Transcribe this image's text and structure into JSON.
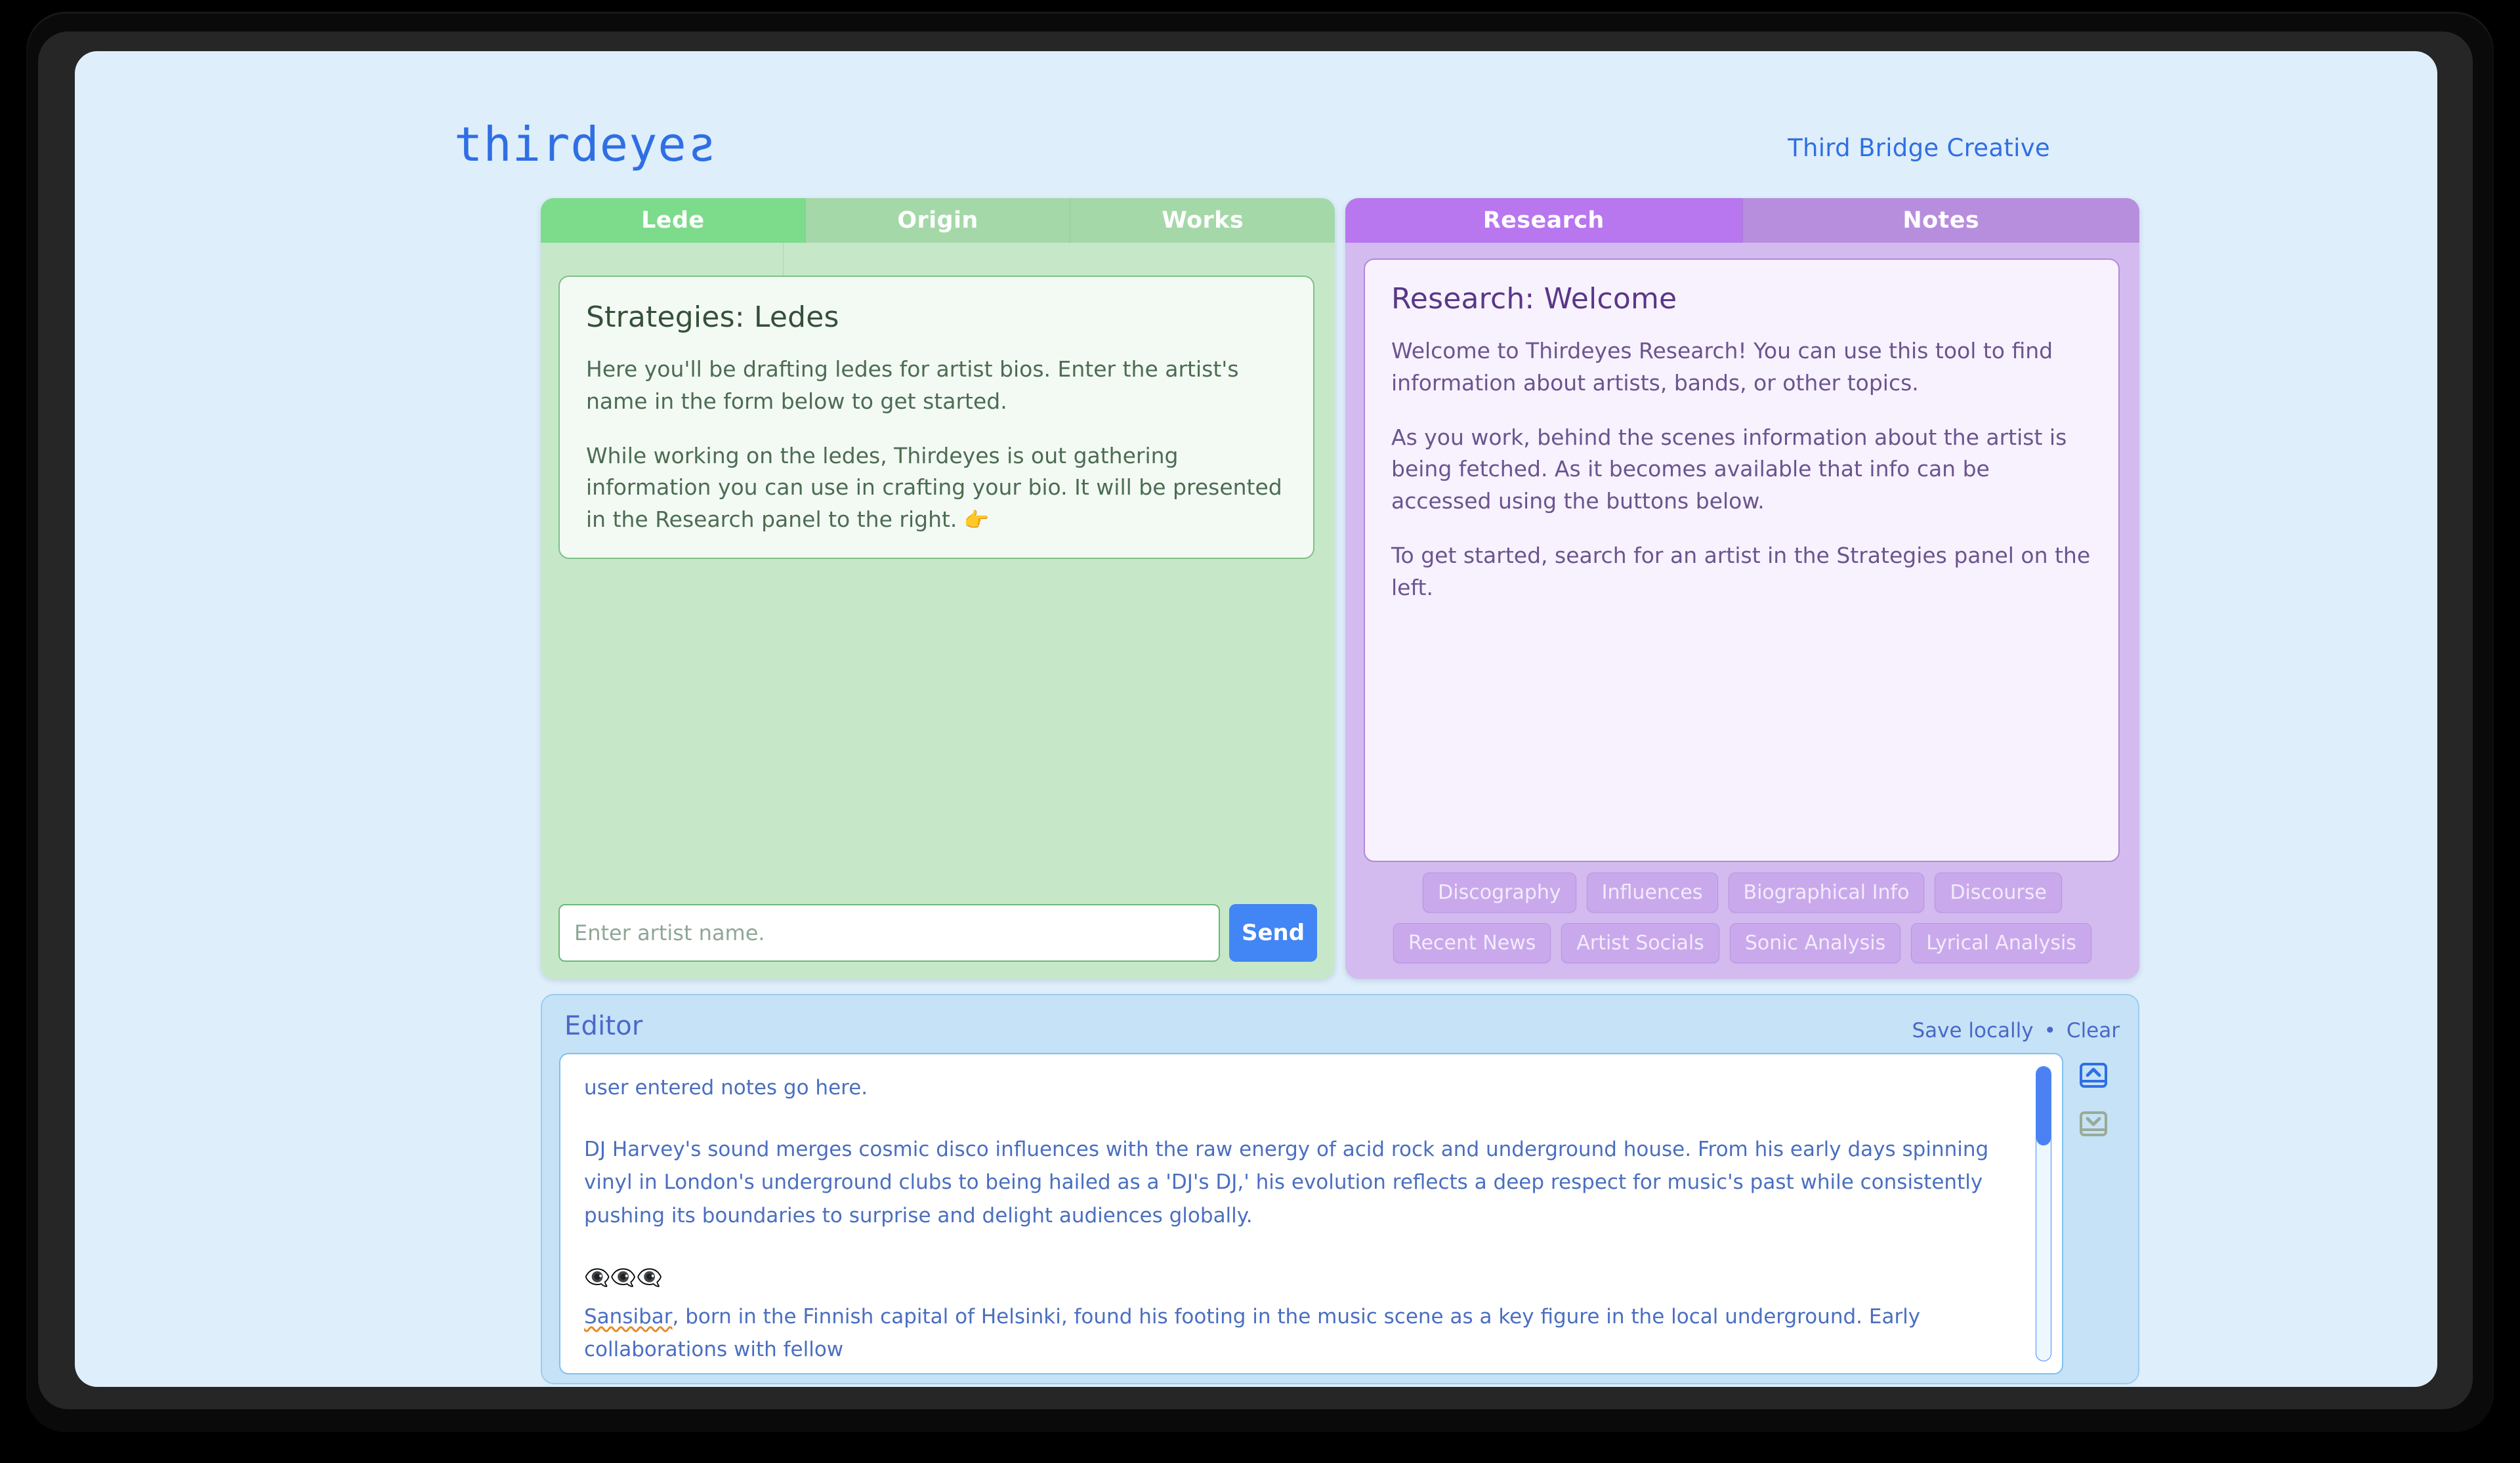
{
  "brand": {
    "logo_text": "thirdeye",
    "logo_text_reversed_letter": "s",
    "credit": "Third Bridge Creative",
    "accent_blue": "#2f6fe4",
    "app_background": "#dfeefb"
  },
  "strategies": {
    "accent": "#7ddb8c",
    "tabs": [
      {
        "label": "Lede",
        "active": true
      },
      {
        "label": "Origin",
        "active": false
      },
      {
        "label": "Works",
        "active": false
      }
    ],
    "card": {
      "title": "Strategies: Ledes",
      "paragraphs": [
        "Here you'll be drafting ledes for artist bios. Enter the artist's name in the form below to get started.",
        "While working on the ledes, Thirdeyes is out gathering information you can use in crafting your bio. It will be presented in the Research panel to the right."
      ],
      "pointer_emoji": "👉"
    },
    "form": {
      "placeholder": "Enter artist name.",
      "value": "",
      "send_label": "Send"
    }
  },
  "research": {
    "accent": "#b876ef",
    "tabs": [
      {
        "label": "Research",
        "active": true
      },
      {
        "label": "Notes",
        "active": false
      }
    ],
    "card": {
      "title": "Research: Welcome",
      "paragraphs": [
        "Welcome to Thirdeyes Research! You can use this tool to find information about artists, bands, or other topics.",
        "As you work, behind the scenes information about the artist is being fetched. As it becomes available that info can be accessed using the buttons below.",
        "To get started, search for an artist in the Strategies panel on the left."
      ]
    },
    "chips": [
      "Discography",
      "Influences",
      "Biographical Info",
      "Discourse",
      "Recent News",
      "Artist Socials",
      "Sonic Analysis",
      "Lyrical Analysis"
    ]
  },
  "editor": {
    "title": "Editor",
    "save_label": "Save locally",
    "separator": "•",
    "clear_label": "Clear",
    "body": {
      "line1": "user entered notes go here.",
      "line2": "DJ Harvey's sound merges cosmic disco influences with the raw energy of acid rock and underground house. From his early days spinning vinyl in London's underground clubs to being hailed as a 'DJ's DJ,' his evolution reflects a deep respect for music's past while consistently pushing its boundaries to surprise and delight audiences globally.",
      "emoji_row": "👁️‍🗨️👁️‍🗨️👁️‍🗨️",
      "line4_misspelled": "Sansibar",
      "line4_rest": ", born in the Finnish capital of Helsinki, found his footing in the music scene as a key figure in the local underground. Early collaborations with fellow"
    },
    "scroll_position_percent": 5,
    "side_buttons": [
      {
        "name": "scroll-to-top-button",
        "icon": "chevron-up-in-box-icon",
        "active": true
      },
      {
        "name": "scroll-to-bottom-button",
        "icon": "chevron-down-in-box-icon",
        "active": false
      }
    ]
  }
}
